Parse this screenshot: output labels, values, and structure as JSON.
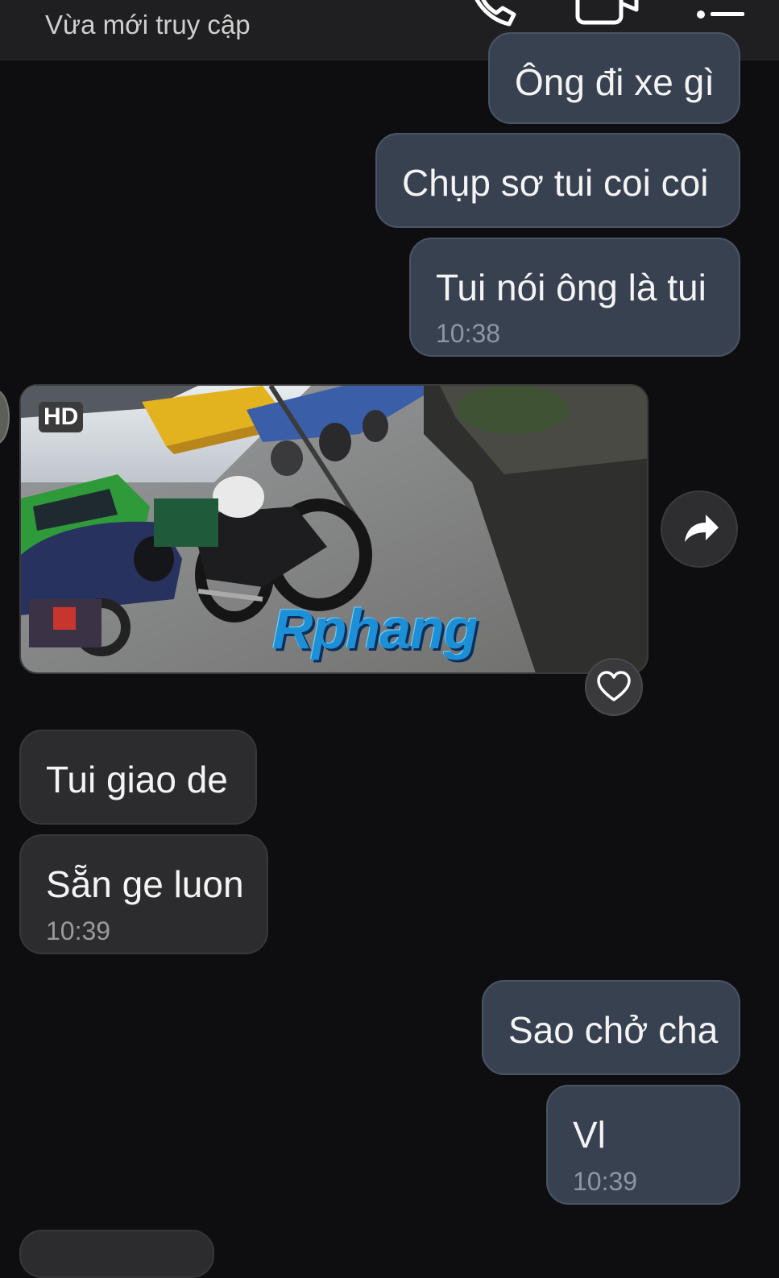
{
  "header": {
    "status": "Vừa mới truy cập"
  },
  "messages": {
    "m1": "Ông đi xe gì",
    "m2": "Chụp sơ tui coi coi",
    "m3": "Tui nói ông là tui",
    "m3_time": "10:38",
    "media_badge": "HD",
    "media_watermark": "Rphang",
    "m4": "Tui giao de",
    "m5": "Sẵn ge luon",
    "m5_time": "10:39",
    "m6": "Sao chở cha",
    "m7": "Vl",
    "m7_time": "10:39"
  },
  "colors": {
    "background": "#0e0e10",
    "outgoing_bubble": "#384150",
    "incoming_bubble": "#2c2c2e",
    "header": "#1f1f21"
  },
  "icons": [
    "phone-icon",
    "video-call-icon",
    "menu-list-icon",
    "share-arrow-icon",
    "heart-icon"
  ]
}
